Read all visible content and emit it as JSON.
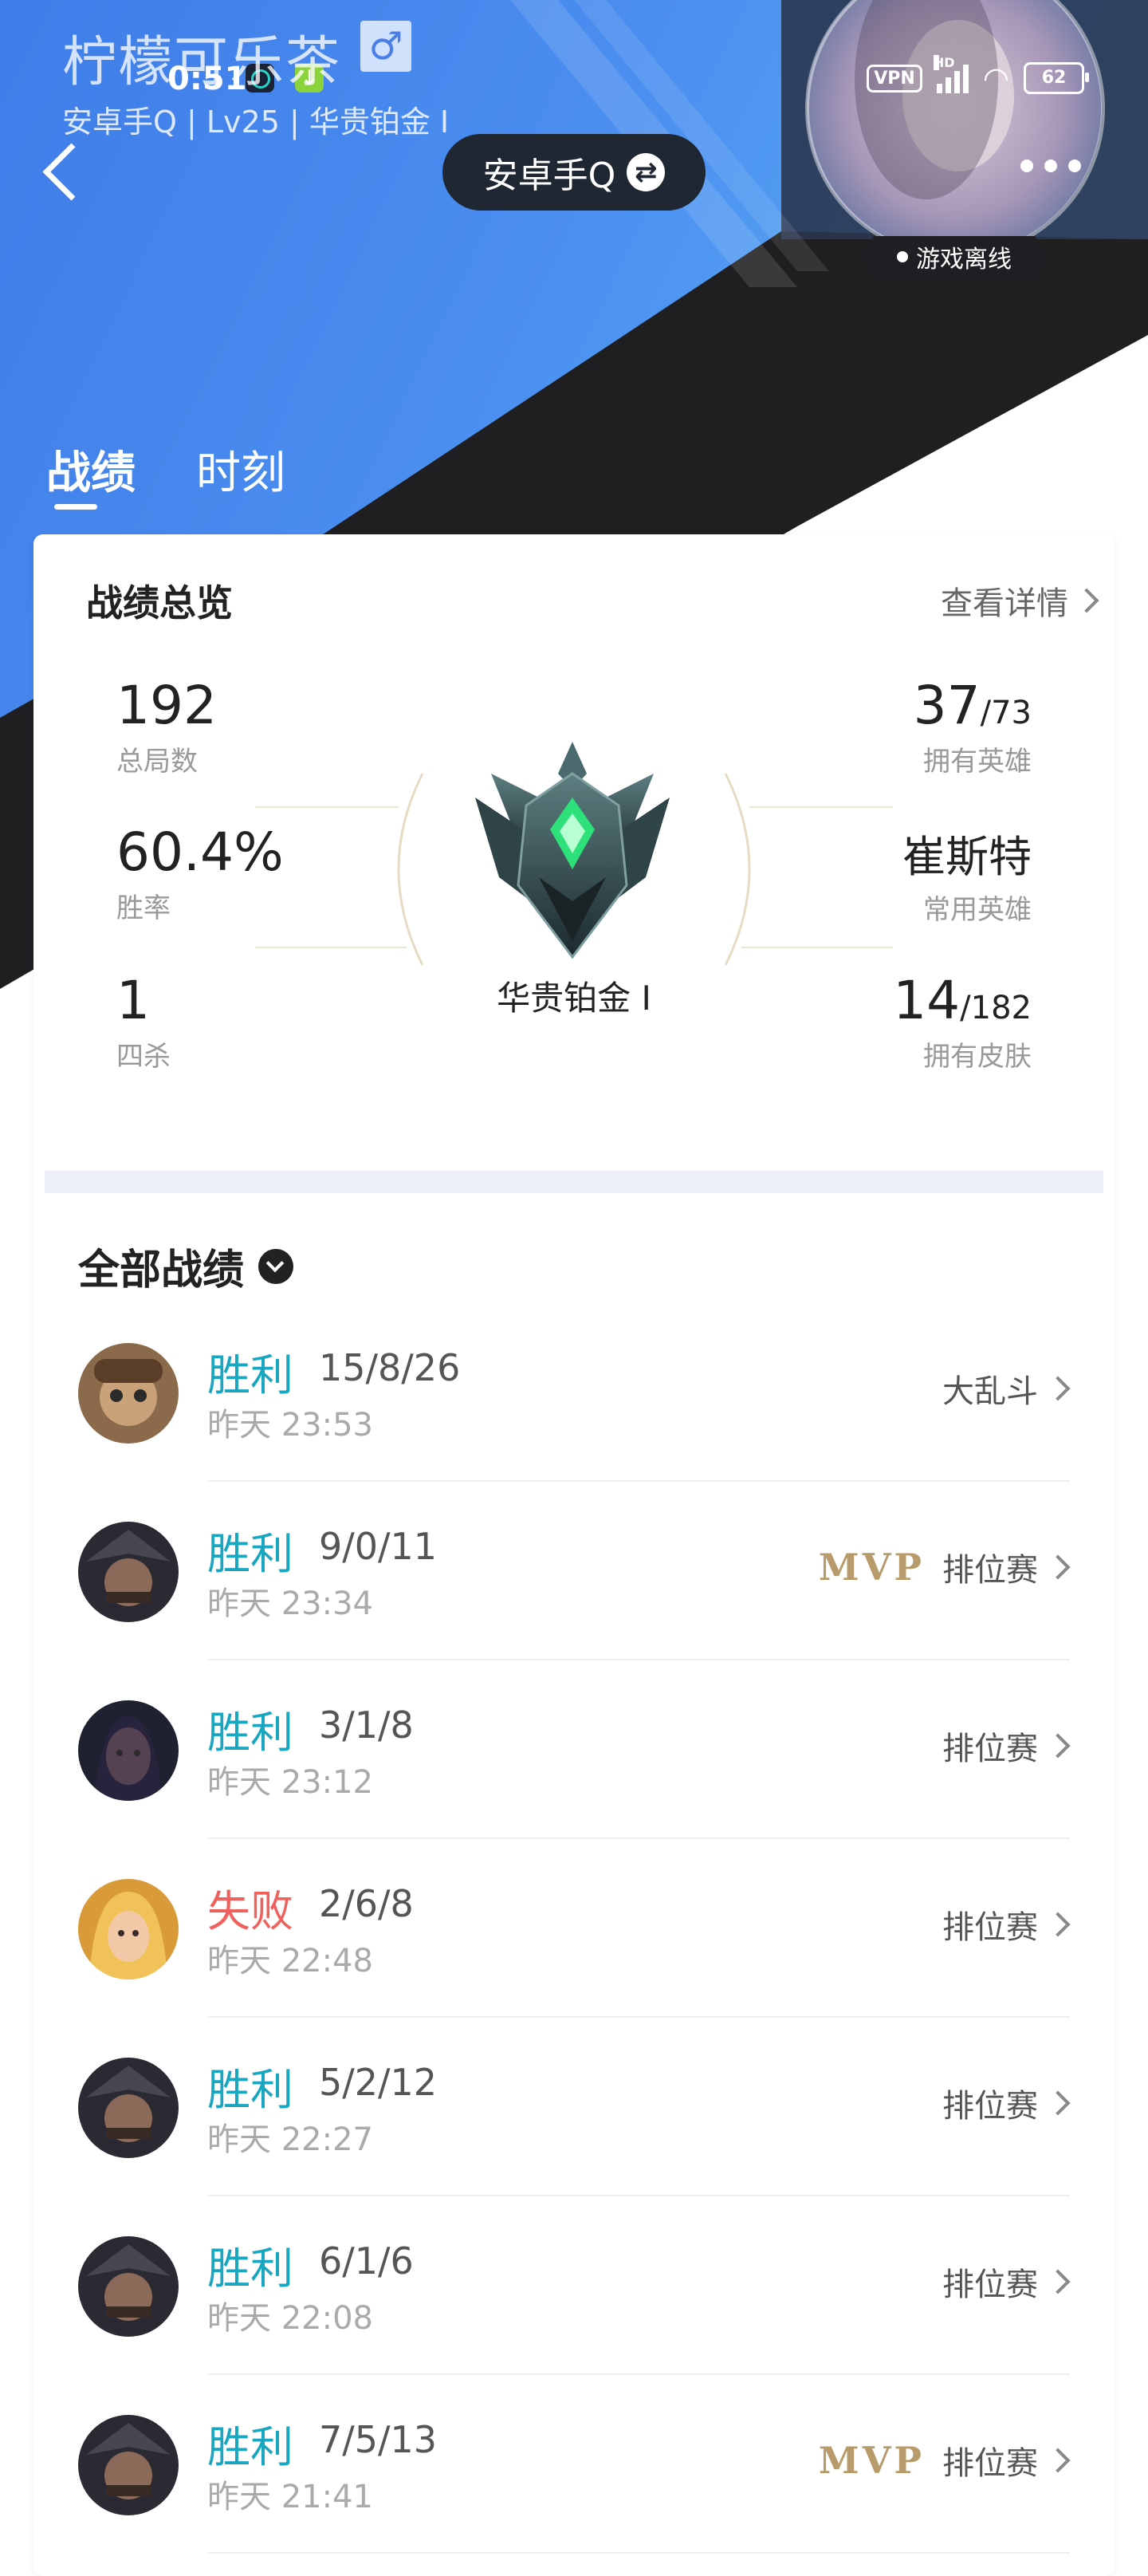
{
  "status_bar": {
    "time": "0:51",
    "vpn": "VPN",
    "hd": "HD",
    "battery": "62"
  },
  "profile": {
    "username": "柠檬可乐茶",
    "gender_symbol": "♂",
    "subtitle": "安卓手Q | Lv25 | 华贵铂金 I",
    "account_switch_label": "安卓手Q",
    "status_badge": "游戏离线"
  },
  "tabs": [
    {
      "label": "战绩"
    },
    {
      "label": "时刻"
    }
  ],
  "overview": {
    "title": "战绩总览",
    "view_detail": "查看详情",
    "stats_left": [
      {
        "value": "192",
        "label": "总局数"
      },
      {
        "value": "60.4%",
        "label": "胜率"
      },
      {
        "value": "1",
        "label": "四杀"
      }
    ],
    "stats_right": [
      {
        "value": "37",
        "sub": "/73",
        "label": "拥有英雄"
      },
      {
        "value": "崔斯特",
        "sub": "",
        "label": "常用英雄"
      },
      {
        "value": "14",
        "sub": "/182",
        "label": "拥有皮肤"
      }
    ],
    "rank": "华贵铂金 I"
  },
  "matches_header": {
    "title": "全部战绩"
  },
  "matches": [
    {
      "result": "胜利",
      "outcome": "win",
      "kda": "15/8/26",
      "time": "昨天 23:53",
      "mode": "大乱斗",
      "mvp": ""
    },
    {
      "result": "胜利",
      "outcome": "win",
      "kda": "9/0/11",
      "time": "昨天 23:34",
      "mode": "排位赛",
      "mvp": "MVP"
    },
    {
      "result": "胜利",
      "outcome": "win",
      "kda": "3/1/8",
      "time": "昨天 23:12",
      "mode": "排位赛",
      "mvp": ""
    },
    {
      "result": "失败",
      "outcome": "lose",
      "kda": "2/6/8",
      "time": "昨天 22:48",
      "mode": "排位赛",
      "mvp": ""
    },
    {
      "result": "胜利",
      "outcome": "win",
      "kda": "5/2/12",
      "time": "昨天 22:27",
      "mode": "排位赛",
      "mvp": ""
    },
    {
      "result": "胜利",
      "outcome": "win",
      "kda": "6/1/6",
      "time": "昨天 22:08",
      "mode": "排位赛",
      "mvp": ""
    },
    {
      "result": "胜利",
      "outcome": "win",
      "kda": "7/5/13",
      "time": "昨天 21:41",
      "mode": "排位赛",
      "mvp": "MVP"
    }
  ],
  "colors": {
    "win": "#18a6c0",
    "lose": "#f0605d",
    "mvp": "#b89b6a",
    "accent_blue": "#4a7fe8"
  }
}
